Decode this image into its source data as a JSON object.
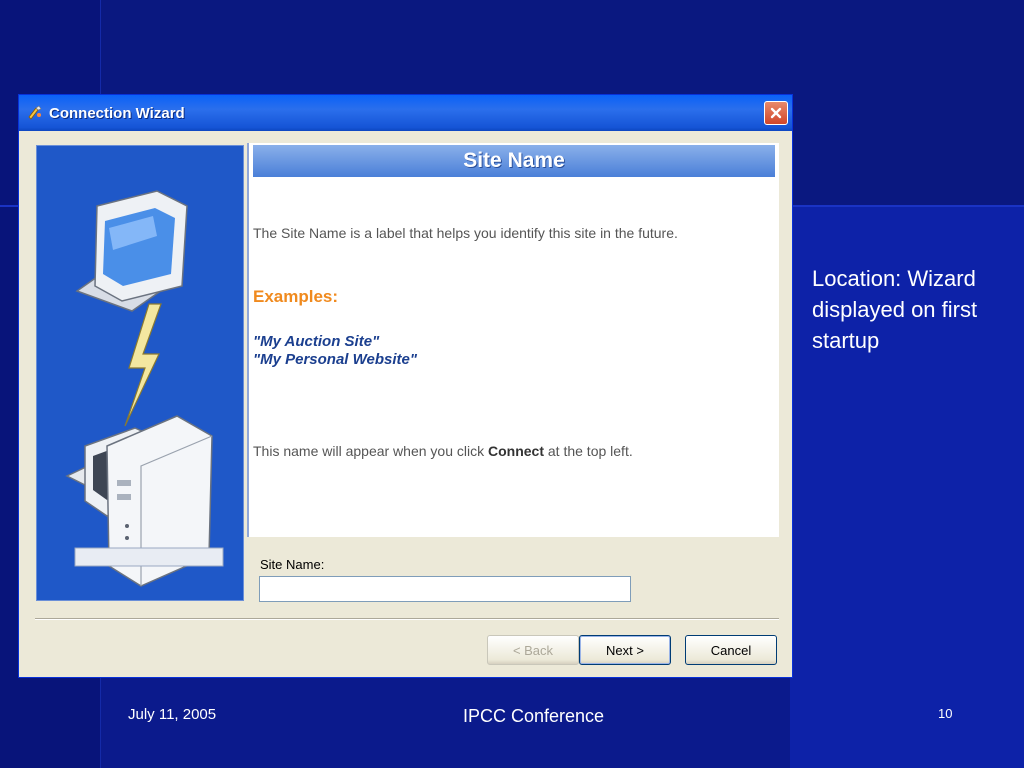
{
  "window": {
    "title": "Connection Wizard"
  },
  "content": {
    "header": "Site Name",
    "description": "The Site Name is a label that helps you identify this site in the future.",
    "examples_label": "Examples:",
    "examples": [
      "\"My Auction Site\"",
      "\"My Personal Website\""
    ],
    "note_prefix": "This name will appear when you click ",
    "note_bold": "Connect",
    "note_suffix": " at the top left."
  },
  "form": {
    "site_name_label": "Site Name:",
    "site_name_value": ""
  },
  "buttons": {
    "back": "< Back",
    "next": "Next >",
    "cancel": "Cancel"
  },
  "slide": {
    "caption": "Location: Wizard displayed on first startup",
    "footer_date": "July 11, 2005",
    "footer_title": "IPCC Conference",
    "page_number": "10"
  },
  "colors": {
    "slide_background": "#0b1a8c",
    "examples_accent": "#f08a1e",
    "example_text": "#1b3f8f"
  }
}
